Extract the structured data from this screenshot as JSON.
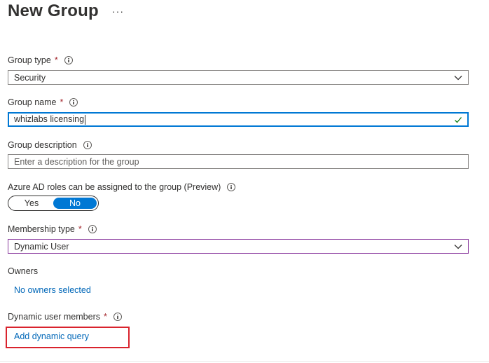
{
  "page": {
    "title": "New Group",
    "more_glyph": "···"
  },
  "group_type": {
    "label": "Group type",
    "required": "*",
    "value": "Security"
  },
  "group_name": {
    "label": "Group name",
    "required": "*",
    "value": "whizlabs licensing"
  },
  "group_description": {
    "label": "Group description",
    "placeholder": "Enter a description for the group"
  },
  "azure_ad_roles": {
    "label": "Azure AD roles can be assigned to the group (Preview)",
    "options": [
      "Yes",
      "No"
    ],
    "selected": "No"
  },
  "membership_type": {
    "label": "Membership type",
    "required": "*",
    "value": "Dynamic User"
  },
  "owners": {
    "label": "Owners",
    "link": "No owners selected"
  },
  "dynamic_members": {
    "label": "Dynamic user members",
    "required": "*",
    "link": "Add dynamic query"
  },
  "colors": {
    "accent": "#0078d4",
    "required": "#a4262c",
    "link": "#0067b8",
    "valid": "#107c10",
    "highlight": "#d9232d",
    "purple_border": "#8a3a9e"
  },
  "icons": [
    "more-icon",
    "info-icon",
    "chevron-down-icon",
    "checkmark-icon"
  ]
}
